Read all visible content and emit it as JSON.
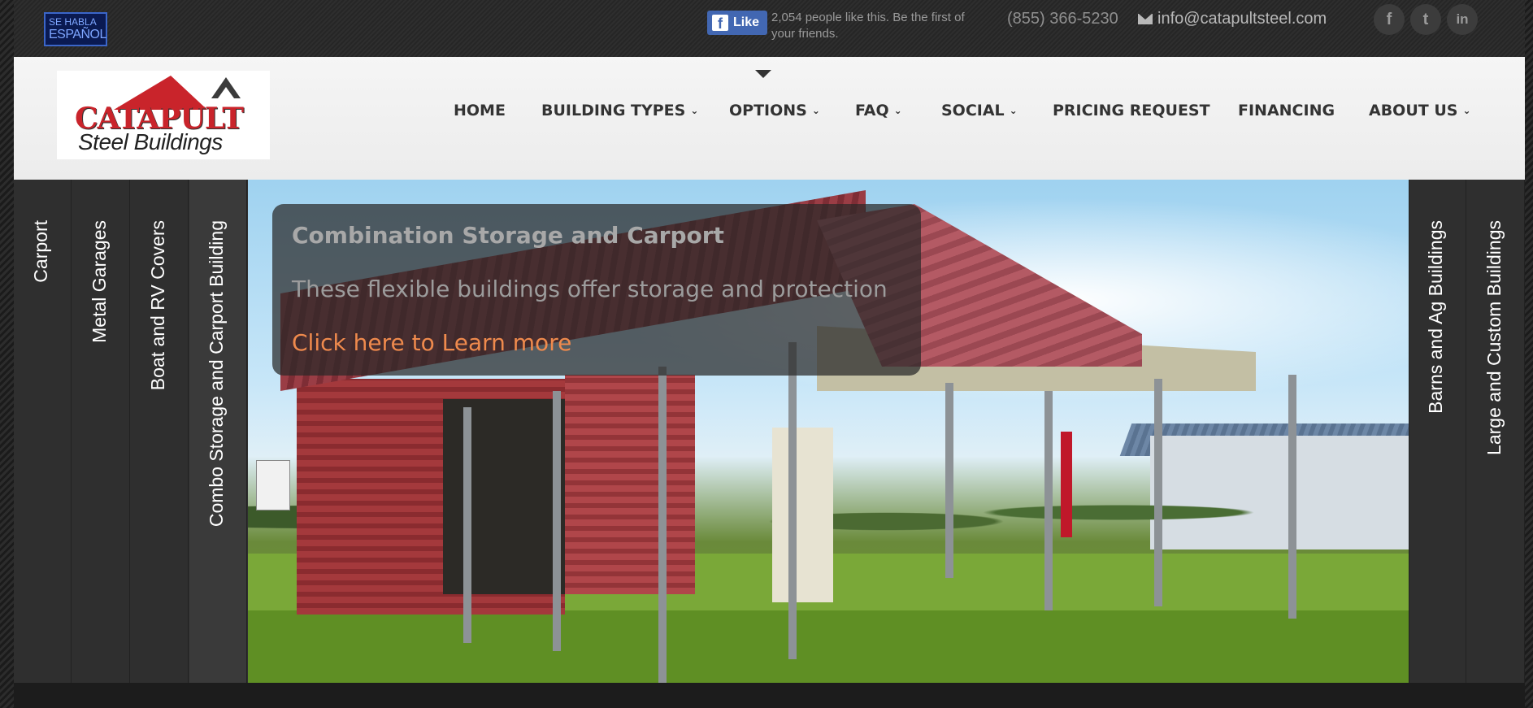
{
  "topbar": {
    "espanol_badge": {
      "line1": "SE HABLA",
      "line2": "ESPAÑOL"
    },
    "facebook": {
      "button_label": "Like",
      "icon": "facebook-icon",
      "text": "2,054 people like this. Be the first of your friends."
    },
    "phone": "(855) 366-5230",
    "email": "info@catapultsteel.com",
    "social_icons": [
      {
        "name": "facebook-icon",
        "glyph": "f"
      },
      {
        "name": "twitter-icon",
        "glyph": "t"
      },
      {
        "name": "linkedin-icon",
        "glyph": "in"
      }
    ]
  },
  "logo": {
    "line1": "CATAPULT",
    "line2": "Steel Buildings",
    "brand_color": "#c9242b"
  },
  "nav": {
    "items": [
      {
        "label": "HOME",
        "dropdown": false
      },
      {
        "label": "BUILDING TYPES",
        "dropdown": true
      },
      {
        "label": "OPTIONS",
        "dropdown": true
      },
      {
        "label": "FAQ",
        "dropdown": true
      },
      {
        "label": "SOCIAL",
        "dropdown": true
      },
      {
        "label": "PRICING REQUEST",
        "dropdown": false
      },
      {
        "label": "FINANCING",
        "dropdown": false
      },
      {
        "label": "ABOUT US",
        "dropdown": true
      }
    ]
  },
  "slider": {
    "left_tabs": [
      "Carport",
      "Metal Garages",
      "Boat and RV Covers",
      "Combo Storage and Carport Building"
    ],
    "right_tabs": [
      "Barns and Ag Buildings",
      "Large and Custom Buildings"
    ],
    "active_tab": "Combo Storage and Carport Building",
    "caption": {
      "title": "Combination Storage and Carport",
      "subtitle": "These flexible buildings offer storage and protection",
      "link": "Click here to Learn more",
      "link_color": "#ef8a4d"
    }
  }
}
